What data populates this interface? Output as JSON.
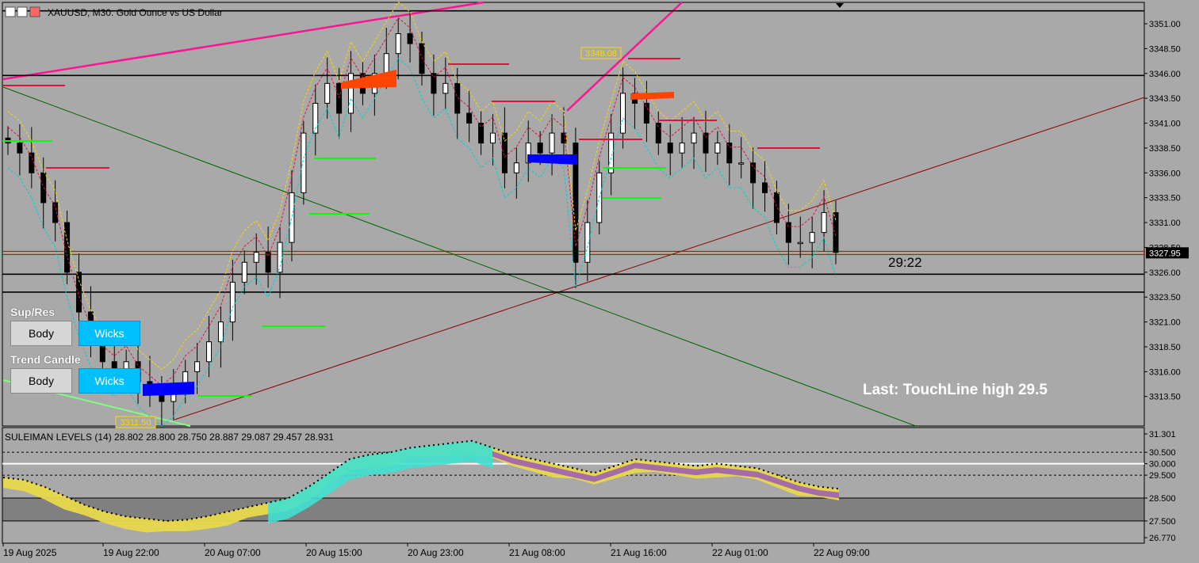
{
  "header": {
    "title": "XAUUSD, M30:  Gold Ounce vs US Dollar"
  },
  "indicator": {
    "title": "SULEIMAN LEVELS (14)  28.802 28.800 28.750 28.887 29.087 29.457 28.931"
  },
  "panels": {
    "sup_res_label": "Sup/Res",
    "sup_res_body": "Body",
    "sup_res_wicks": "Wicks",
    "trend_label": "Trend Candle",
    "trend_body": "Body",
    "trend_wicks": "Wicks"
  },
  "status": "Last: TouchLine high 29.5",
  "timer": "29:22",
  "chart_data": [
    {
      "type": "candlestick",
      "symbol": "XAUUSD",
      "timeframe": "M30",
      "ylim": [
        3311,
        3352.5
      ],
      "y_ticks": [
        "3351.00",
        "3348.50",
        "3346.00",
        "3343.50",
        "3341.00",
        "3338.50",
        "3336.00",
        "3333.50",
        "3331.00",
        "3328.50",
        "3326.00",
        "3323.50",
        "3321.00",
        "3318.50",
        "3316.00",
        "3313.50"
      ],
      "x_ticks": [
        "19 Aug 2025",
        "19 Aug 22:00",
        "20 Aug 07:00",
        "20 Aug 15:00",
        "20 Aug 23:00",
        "21 Aug 08:00",
        "21 Aug 16:00",
        "22 Aug 01:00",
        "22 Aug 09:00"
      ],
      "current_price": "3327.95",
      "annotations": [
        "3348.08",
        "3311.50"
      ],
      "horizontal_levels": [
        3352.3,
        3345.8,
        3325.8,
        3324.0
      ],
      "close_path": [
        3339,
        3338,
        3336,
        3333,
        3331,
        3326,
        3322,
        3319,
        3317,
        3316,
        3317,
        3315,
        3314,
        3313,
        3314,
        3316,
        3317,
        3319,
        3321,
        3325,
        3327,
        3328,
        3326,
        3329,
        3334,
        3340,
        3343,
        3345,
        3342,
        3346,
        3344,
        3346,
        3348,
        3350,
        3349,
        3346,
        3344,
        3345,
        3342,
        3341,
        3339,
        3340,
        3336,
        3337,
        3339,
        3338,
        3340,
        3339,
        3327,
        3331,
        3336,
        3340,
        3344,
        3343,
        3341,
        3339,
        3338,
        3339,
        3340,
        3338,
        3339,
        3337,
        3337,
        3335,
        3334,
        3331,
        3329,
        3329,
        3330,
        3332,
        3328
      ],
      "grid": false,
      "legend": "none"
    },
    {
      "type": "area",
      "name": "SULEIMAN LEVELS (14)",
      "ylim": [
        26.77,
        31.301
      ],
      "y_ticks": [
        "31.301",
        "30.500",
        "30.000",
        "29.500",
        "28.500",
        "27.500",
        "26.770"
      ],
      "levels": [
        30.5,
        30.0,
        29.5
      ],
      "band": [
        27.5,
        28.5
      ],
      "series_path": [
        29.4,
        29.3,
        29.0,
        28.6,
        28.2,
        27.9,
        27.7,
        27.6,
        27.5,
        27.55,
        27.7,
        27.9,
        28.1,
        28.3,
        28.5,
        29.0,
        29.6,
        30.2,
        30.4,
        30.5,
        30.7,
        30.8,
        30.9,
        31.0,
        30.7,
        30.4,
        30.2,
        30.0,
        29.8,
        29.6,
        29.9,
        30.2,
        30.1,
        30.0,
        29.9,
        30.0,
        29.9,
        29.8,
        29.5,
        29.2,
        29.0,
        28.9
      ]
    }
  ]
}
